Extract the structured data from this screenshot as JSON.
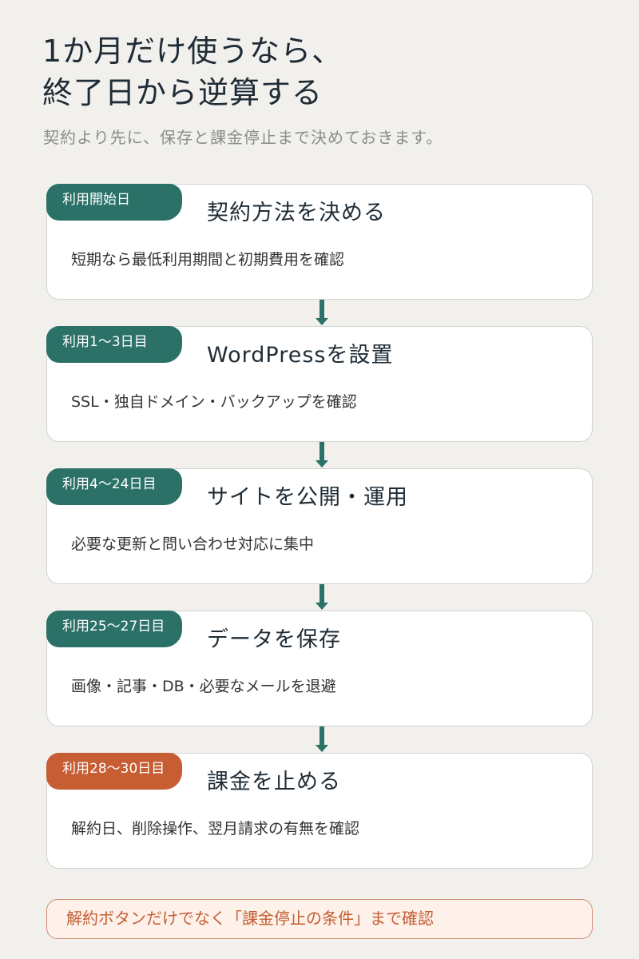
{
  "title_line1": "1か月だけ使うなら、",
  "title_line2": "終了日から逆算する",
  "subtitle": "契約より先に、保存と課金停止まで決めておきます。",
  "steps": [
    {
      "badge": "利用開始日",
      "title": "契約方法を決める",
      "desc": "短期なら最低利用期間と初期費用を確認"
    },
    {
      "badge": "利用1〜3日目",
      "title": "WordPressを設置",
      "desc": "SSL・独自ドメイン・バックアップを確認"
    },
    {
      "badge": "利用4〜24日目",
      "title": "サイトを公開・運用",
      "desc": "必要な更新と問い合わせ対応に集中"
    },
    {
      "badge": "利用25〜27日目",
      "title": "データを保存",
      "desc": "画像・記事・DB・必要なメールを退避"
    },
    {
      "badge": "利用28〜30日目",
      "title": "課金を止める",
      "desc": "解約日、削除操作、翌月請求の有無を確認"
    }
  ],
  "note": "解約ボタンだけでなく「課金停止の条件」まで確認",
  "colors": {
    "background": "#f1f0ed",
    "teal": "#2b7168",
    "orange": "#c65d33",
    "note_bg": "#fdf1ea"
  }
}
